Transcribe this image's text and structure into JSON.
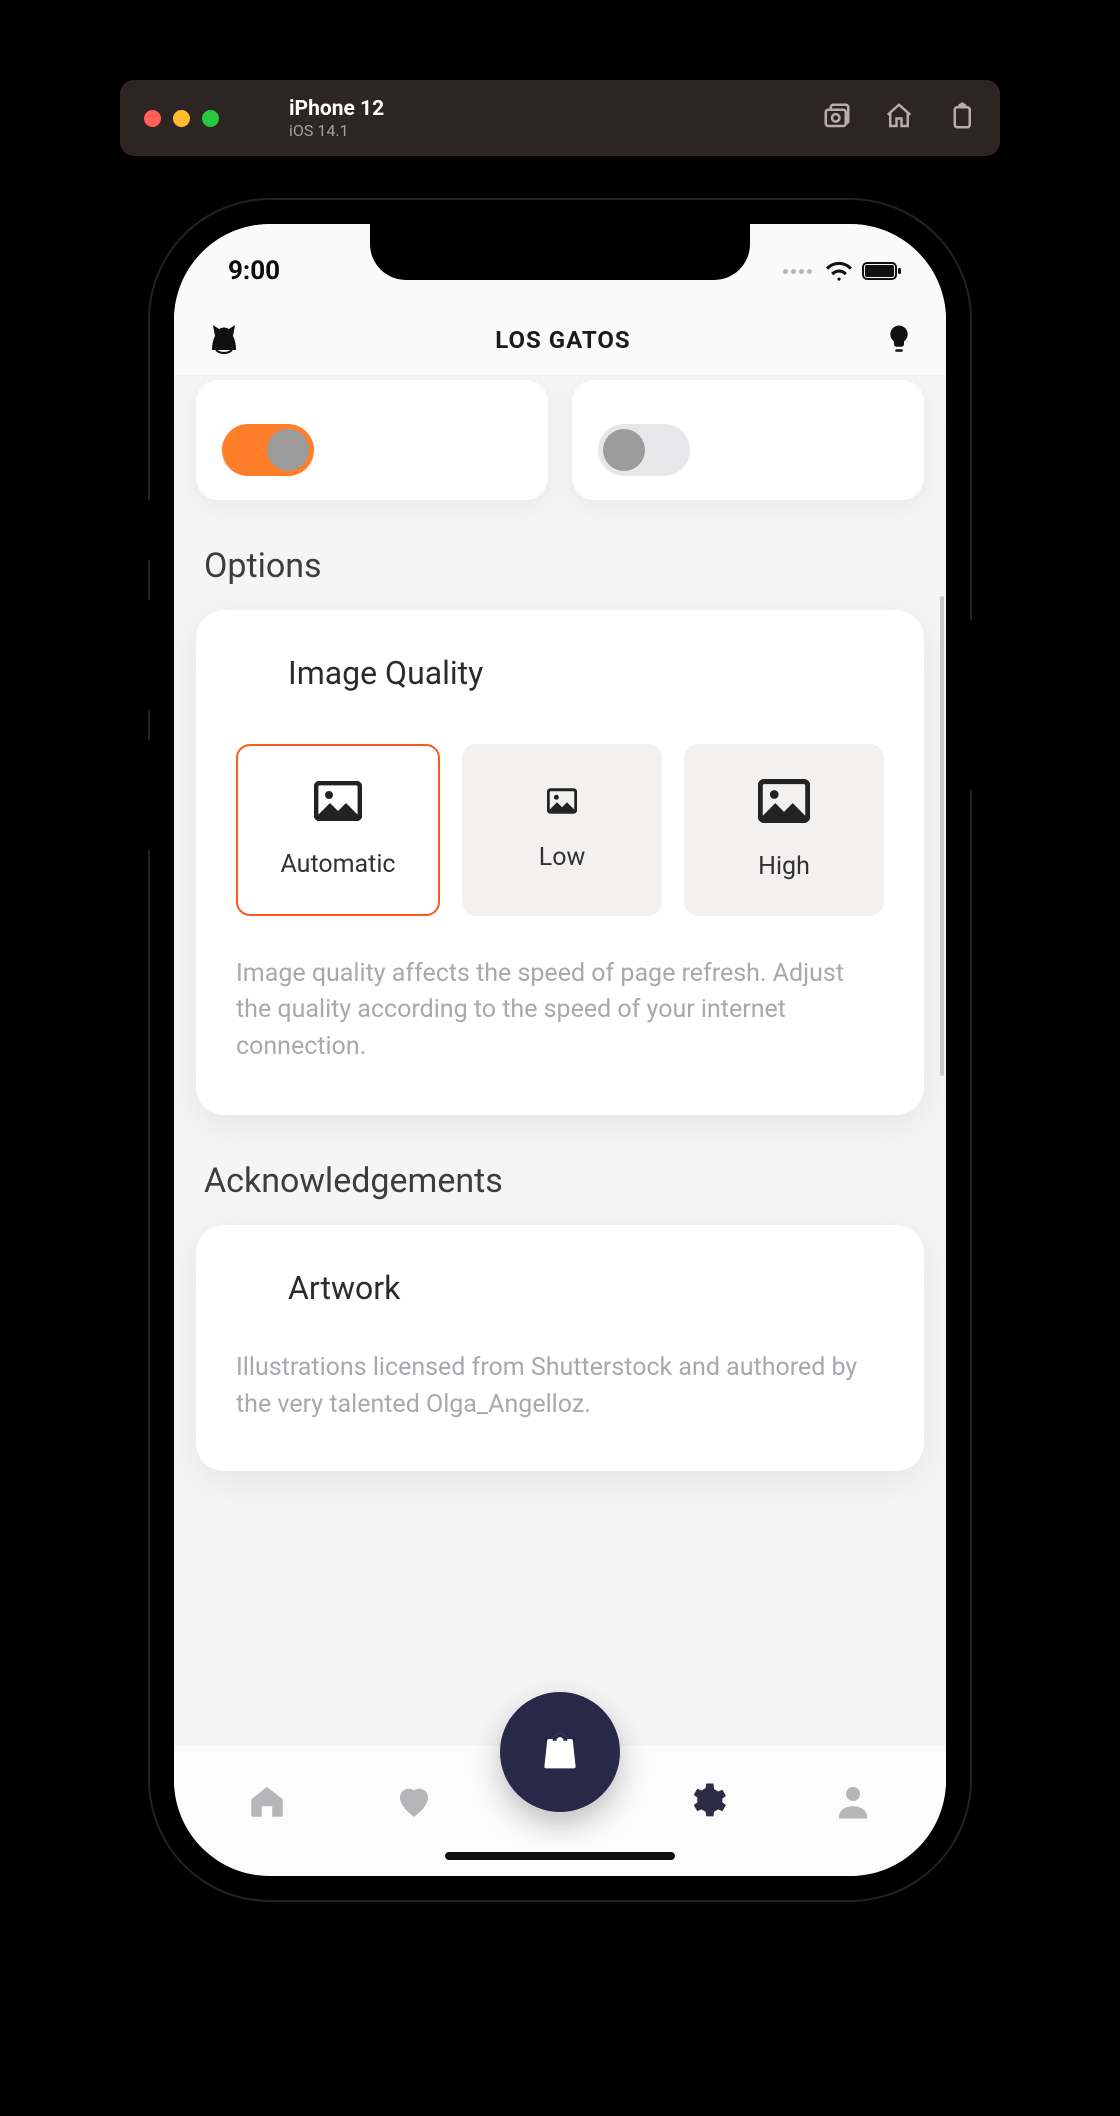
{
  "window": {
    "device_name": "iPhone 12",
    "os_version": "iOS 14.1"
  },
  "status": {
    "time": "9:00"
  },
  "header": {
    "title": "LOS GATOS"
  },
  "toggles": {
    "left_on": true,
    "right_on": false
  },
  "sections": {
    "options_label": "Options",
    "acknowledgements_label": "Acknowledgements"
  },
  "image_quality": {
    "title": "Image Quality",
    "options": [
      {
        "label": "Automatic",
        "selected": true
      },
      {
        "label": "Low",
        "selected": false
      },
      {
        "label": "High",
        "selected": false
      }
    ],
    "description": "Image quality affects the speed of page refresh. Adjust the quality according to the speed of your internet connection."
  },
  "acknowledgements": {
    "title": "Artwork",
    "body": "Illustrations licensed from Shutterstock and authored by the very talented Olga_Angelloz."
  }
}
